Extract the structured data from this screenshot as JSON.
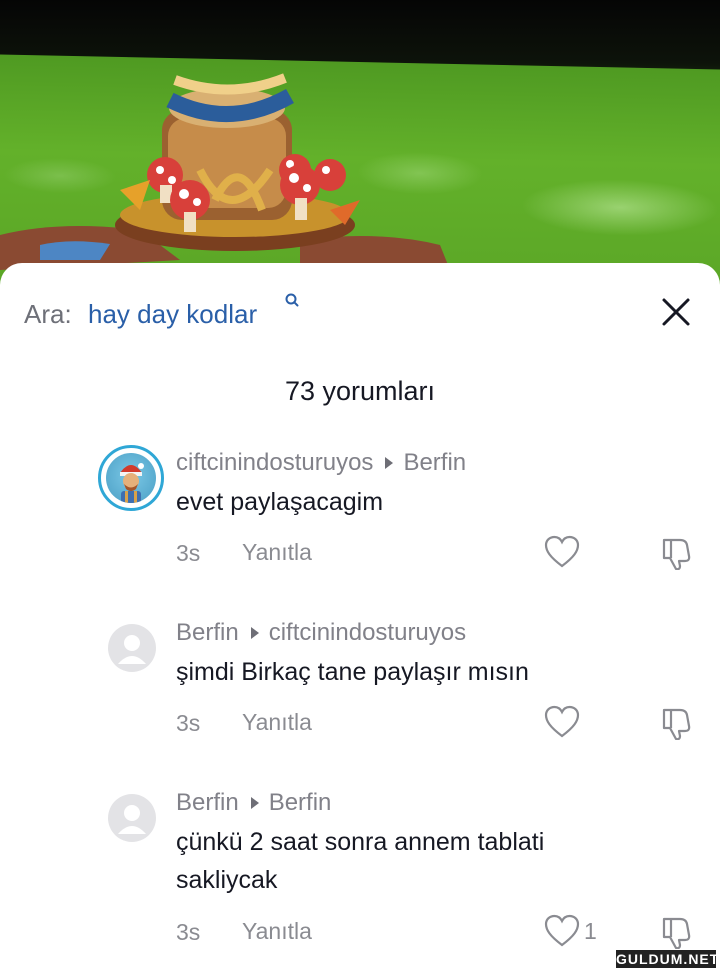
{
  "search": {
    "label": "Ara:",
    "query": "hay day kodlar"
  },
  "comments_header": {
    "count_label": "73 yorumları"
  },
  "comments": [
    {
      "author": "ciftcinindosturuyos",
      "reply_to": "Berfin",
      "text": "evet paylaşacagim",
      "time": "3s",
      "reply_label": "Yanıtla",
      "likes": ""
    },
    {
      "author": "Berfin",
      "reply_to": "ciftcinindosturuyos",
      "text": "şimdi Birkaç tane paylaşır mısın",
      "time": "3s",
      "reply_label": "Yanıtla",
      "likes": ""
    },
    {
      "author": "Berfin",
      "reply_to": "Berfin",
      "text_line1": "çünkü 2 saat sonra annem tablati",
      "text_line2": "sakliycak",
      "time": "3s",
      "reply_label": "Yanıtla",
      "likes": "1"
    }
  ],
  "watermark": "GULDUM.NET",
  "colors": {
    "accent": "#2a5fa8",
    "avatar_ring": "#2fa7d6",
    "text": "#161823",
    "muted": "#8a8b91"
  }
}
